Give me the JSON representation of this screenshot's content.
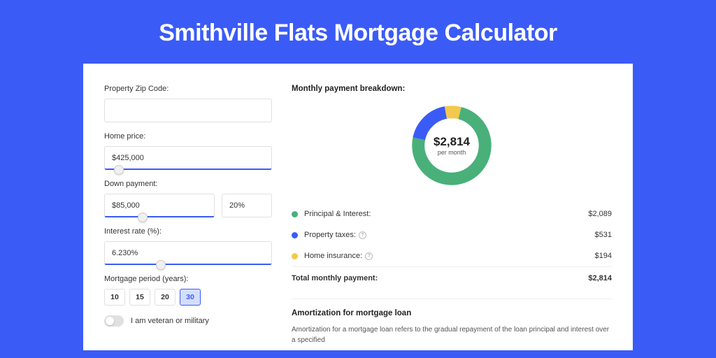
{
  "page": {
    "title": "Smithville Flats Mortgage Calculator"
  },
  "form": {
    "zip": {
      "label": "Property Zip Code:",
      "value": ""
    },
    "home_price": {
      "label": "Home price:",
      "value": "$425,000",
      "slider_pos": "6%"
    },
    "down_payment": {
      "label": "Down payment:",
      "amount": "$85,000",
      "percent": "20%",
      "slider_pos": "20%"
    },
    "interest": {
      "label": "Interest rate (%):",
      "value": "6.230%",
      "slider_pos": "31%"
    },
    "period": {
      "label": "Mortgage period (years):",
      "options": [
        "10",
        "15",
        "20",
        "30"
      ],
      "selected": "30"
    },
    "veteran": {
      "label": "I am veteran or military",
      "checked": false
    }
  },
  "breakdown": {
    "title": "Monthly payment breakdown:",
    "donut": {
      "amount": "$2,814",
      "sub": "per month"
    },
    "items": [
      {
        "label": "Principal & Interest:",
        "value": "$2,089",
        "color": "green",
        "help": false
      },
      {
        "label": "Property taxes:",
        "value": "$531",
        "color": "blue",
        "help": true
      },
      {
        "label": "Home insurance:",
        "value": "$194",
        "color": "yellow",
        "help": true
      }
    ],
    "total": {
      "label": "Total monthly payment:",
      "value": "$2,814"
    }
  },
  "amortization": {
    "title": "Amortization for mortgage loan",
    "text": "Amortization for a mortgage loan refers to the gradual repayment of the loan principal and interest over a specified"
  },
  "chart_data": {
    "type": "pie",
    "title": "Monthly payment breakdown",
    "series": [
      {
        "name": "Principal & Interest",
        "value": 2089,
        "color": "#49b07a"
      },
      {
        "name": "Property taxes",
        "value": 531,
        "color": "#3b5bf7"
      },
      {
        "name": "Home insurance",
        "value": 194,
        "color": "#f2c94c"
      }
    ],
    "total": 2814
  }
}
